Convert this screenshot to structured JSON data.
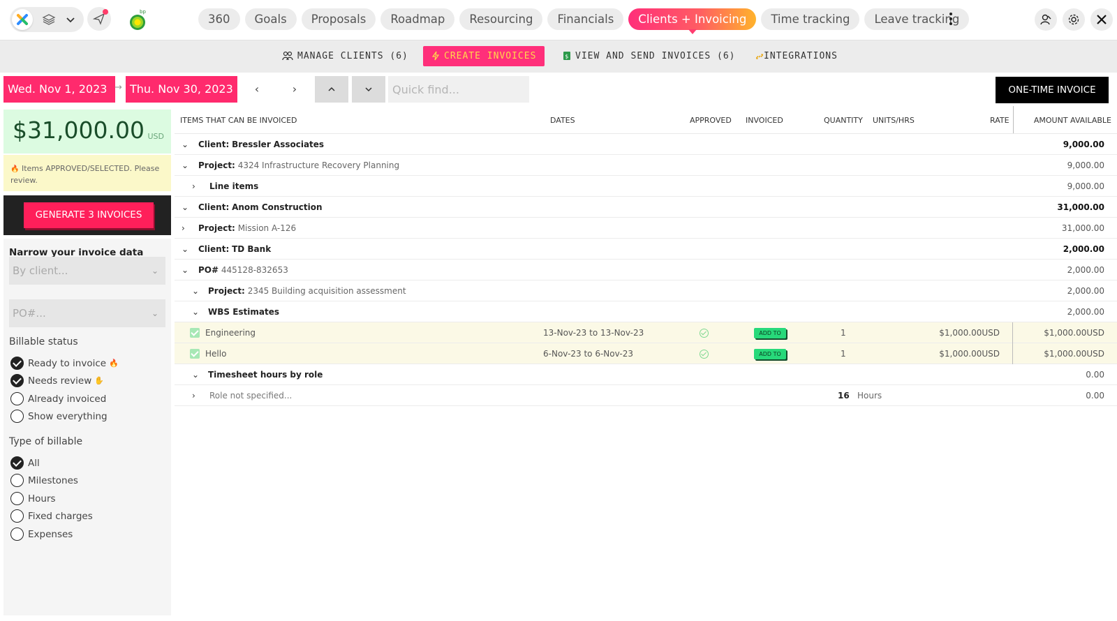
{
  "nav": {
    "tabs": [
      {
        "label": "360"
      },
      {
        "label": "Goals"
      },
      {
        "label": "Proposals"
      },
      {
        "label": "Roadmap"
      },
      {
        "label": "Resourcing"
      },
      {
        "label": "Financials"
      },
      {
        "label": "Clients + Invoicing",
        "active": true
      },
      {
        "label": "Time tracking"
      },
      {
        "label": "Leave tracking"
      }
    ],
    "brand_mark": "bp"
  },
  "subnav": {
    "manage_clients": "MANAGE CLIENTS (6)",
    "create_invoices": "CREATE INVOICES",
    "view_send": "VIEW AND SEND INVOICES (6)",
    "integrations": "INTEGRATIONS"
  },
  "toolbar": {
    "start_date": "Wed. Nov 1, 2023",
    "end_date": "Thu. Nov 30, 2023",
    "quick_find_placeholder": "Quick find...",
    "one_time_invoice": "ONE-TIME INVOICE"
  },
  "summary": {
    "total": "$31,000.00",
    "currency": "USD",
    "warning": "Items APPROVED/SELECTED. Please review.",
    "generate_label": "GENERATE 3 INVOICES"
  },
  "filters": {
    "title": "Narrow your invoice data",
    "client_placeholder": "By client...",
    "po_placeholder": "PO#...",
    "billable_status_title": "Billable status",
    "billable_status": [
      {
        "label": "Ready to invoice",
        "checked": true
      },
      {
        "label": "Needs review",
        "checked": true
      },
      {
        "label": "Already invoiced",
        "checked": false
      },
      {
        "label": "Show everything",
        "checked": false
      }
    ],
    "type_title": "Type of billable",
    "types": [
      {
        "label": "All",
        "checked": true
      },
      {
        "label": "Milestones",
        "checked": false
      },
      {
        "label": "Hours",
        "checked": false
      },
      {
        "label": "Fixed charges",
        "checked": false
      },
      {
        "label": "Expenses",
        "checked": false
      }
    ]
  },
  "table": {
    "headers": {
      "items": "ITEMS THAT CAN BE INVOICED",
      "dates": "DATES",
      "approved": "APPROVED",
      "invoiced": "INVOICED",
      "quantity": "QUANTITY",
      "units": "UNITS/HRS",
      "rate": "RATE",
      "amount": "AMOUNT AVAILABLE"
    },
    "rows": [
      {
        "prefix": "Client:",
        "name": "Bressler Associates",
        "amount": "9,000.00"
      },
      {
        "prefix": "Project:",
        "name": "4324 Infrastructure Recovery Planning",
        "amount": "9,000.00"
      },
      {
        "prefix": "",
        "name": "Line items",
        "amount": "9,000.00"
      },
      {
        "prefix": "Client:",
        "name": "Anom Construction",
        "amount": "31,000.00"
      },
      {
        "prefix": "Project:",
        "name": "Mission A-126",
        "amount": "31,000.00"
      },
      {
        "prefix": "Client:",
        "name": "TD Bank",
        "amount": "2,000.00"
      },
      {
        "prefix": "PO#",
        "name": "445128-832653",
        "amount": "2,000.00"
      },
      {
        "prefix": "Project:",
        "name": "2345 Building acquisition assessment",
        "amount": "2,000.00"
      },
      {
        "prefix": "",
        "name": "WBS Estimates",
        "amount": "2,000.00"
      },
      {
        "name": "Engineering",
        "dates": "13-Nov-23 to 13-Nov-23",
        "invoiced": "ADD TO",
        "quantity": "1",
        "rate": "$1,000.00USD",
        "amount": "$1,000.00USD"
      },
      {
        "name": "Hello",
        "dates": "6-Nov-23 to 6-Nov-23",
        "invoiced": "ADD TO",
        "quantity": "1",
        "rate": "$1,000.00USD",
        "amount": "$1,000.00USD"
      },
      {
        "prefix": "",
        "name": "Timesheet hours by role",
        "amount": "0.00"
      },
      {
        "name": "Role not specified...",
        "quantity": "16",
        "units": "Hours",
        "amount": "0.00"
      }
    ]
  }
}
